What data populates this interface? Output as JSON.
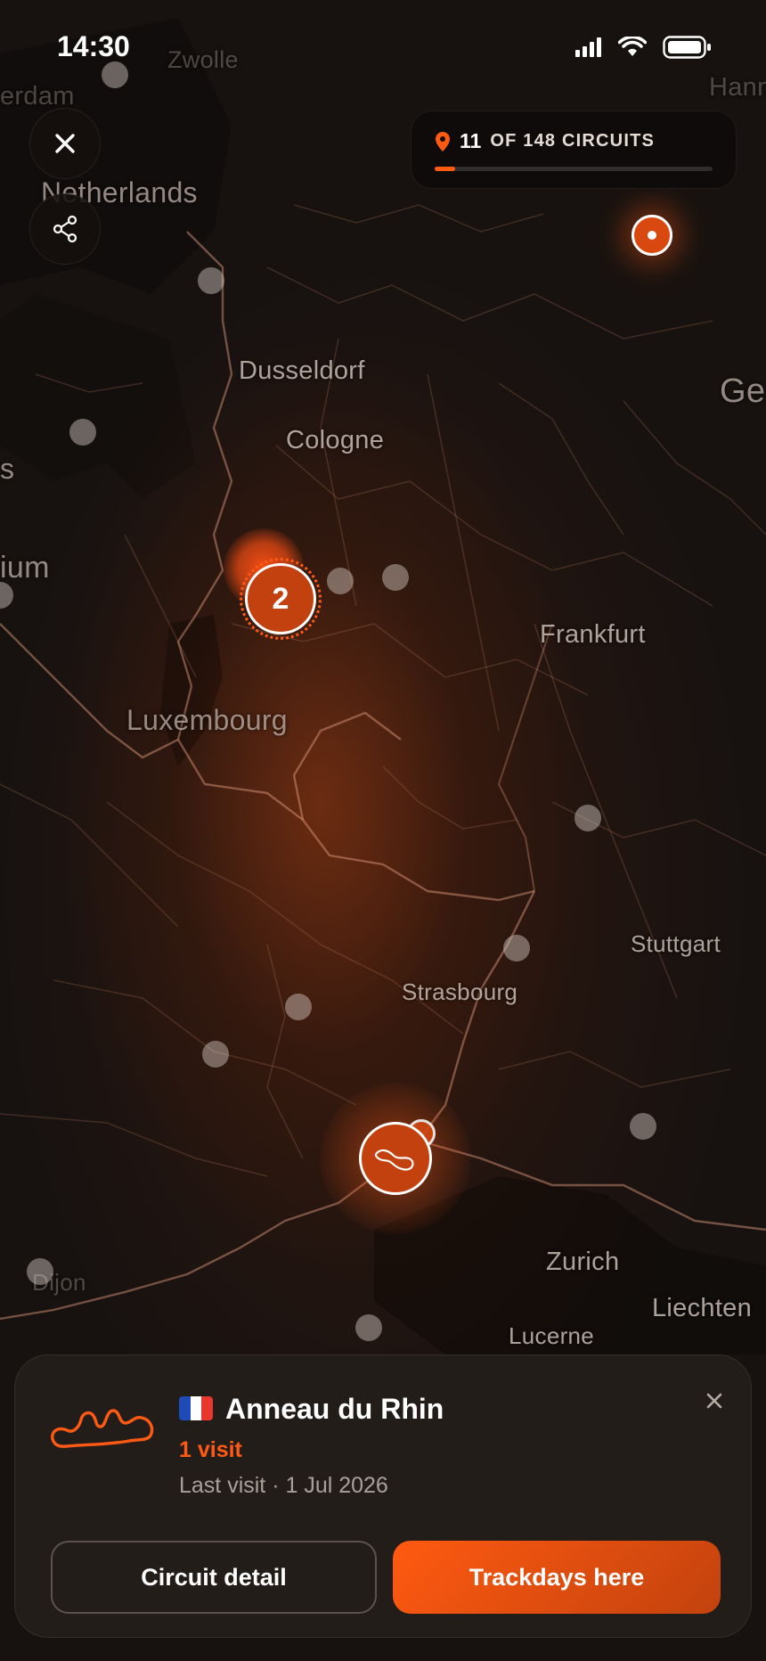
{
  "status_bar": {
    "time": "14:30"
  },
  "counter": {
    "visited": "11",
    "label": "OF 148 CIRCUITS",
    "progress": 0.074
  },
  "map": {
    "cities": {
      "zwolle": "Zwolle",
      "erdam": "erdam",
      "hann": "Hann",
      "netherlands": "Netherlands",
      "dusseldorf": "Dusseldorf",
      "cologne": "Cologne",
      "ge": "Ge",
      "s": "s",
      "ium": "ium",
      "frankfurt": "Frankfurt",
      "luxembourg": "Luxembourg",
      "stuttgart": "Stuttgart",
      "strasbourg": "Strasbourg",
      "zurich": "Zurich",
      "dijon": "Dijon",
      "liechten": "Liechten",
      "lucerne": "Lucerne"
    },
    "cluster_count": "2"
  },
  "circuit_card": {
    "name": "Anneau du Rhin",
    "country_flag": "France",
    "visits": "1 visit",
    "last_visit": "Last visit · 1 Jul 2026",
    "detail_button": "Circuit detail",
    "trackdays_button": "Trackdays here"
  },
  "colors": {
    "accent": "#ff5a12",
    "card_bg": "#231d1a",
    "map_bg": "#171210"
  }
}
